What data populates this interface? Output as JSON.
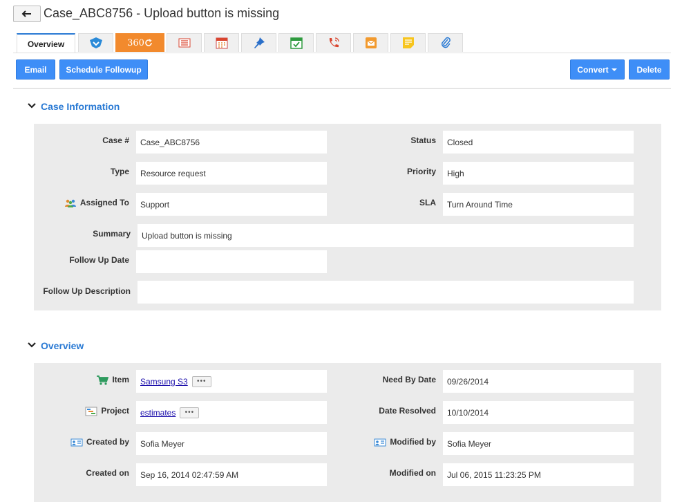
{
  "header": {
    "title": "Case_ABC8756 - Upload button is missing"
  },
  "tabs": {
    "overview_label": "Overview",
    "tab360_label": "360"
  },
  "actions": {
    "email": "Email",
    "schedule": "Schedule Followup",
    "convert": "Convert",
    "delete": "Delete"
  },
  "case_info": {
    "title": "Case Information",
    "case_no_label": "Case #",
    "case_no": "Case_ABC8756",
    "status_label": "Status",
    "status": "Closed",
    "type_label": "Type",
    "type": "Resource request",
    "priority_label": "Priority",
    "priority": "High",
    "assigned_label": "Assigned To",
    "assigned": "Support",
    "sla_label": "SLA",
    "sla": "Turn Around Time",
    "summary_label": "Summary",
    "summary": "Upload button is missing",
    "followup_date_label": "Follow Up Date",
    "followup_date": "",
    "followup_desc_label": "Follow Up Description",
    "followup_desc": ""
  },
  "overview": {
    "title": "Overview",
    "item_label": "Item",
    "item": "Samsung S3",
    "need_by_label": "Need By Date",
    "need_by": "09/26/2014",
    "project_label": "Project",
    "project": "estimates",
    "resolved_label": "Date Resolved",
    "resolved": "10/10/2014",
    "created_by_label": "Created by",
    "created_by": "Sofia Meyer",
    "modified_by_label": "Modified by",
    "modified_by": "Sofia Meyer",
    "created_on_label": "Created on",
    "created_on": "Sep 16, 2014 02:47:59 AM",
    "modified_on_label": "Modified on",
    "modified_on": "Jul 06, 2015 11:23:25 PM"
  },
  "colors": {
    "accent": "#3e8ef7",
    "section_title": "#2a7ad4",
    "tab360": "#f28a2d",
    "panel": "#ebebeb"
  }
}
